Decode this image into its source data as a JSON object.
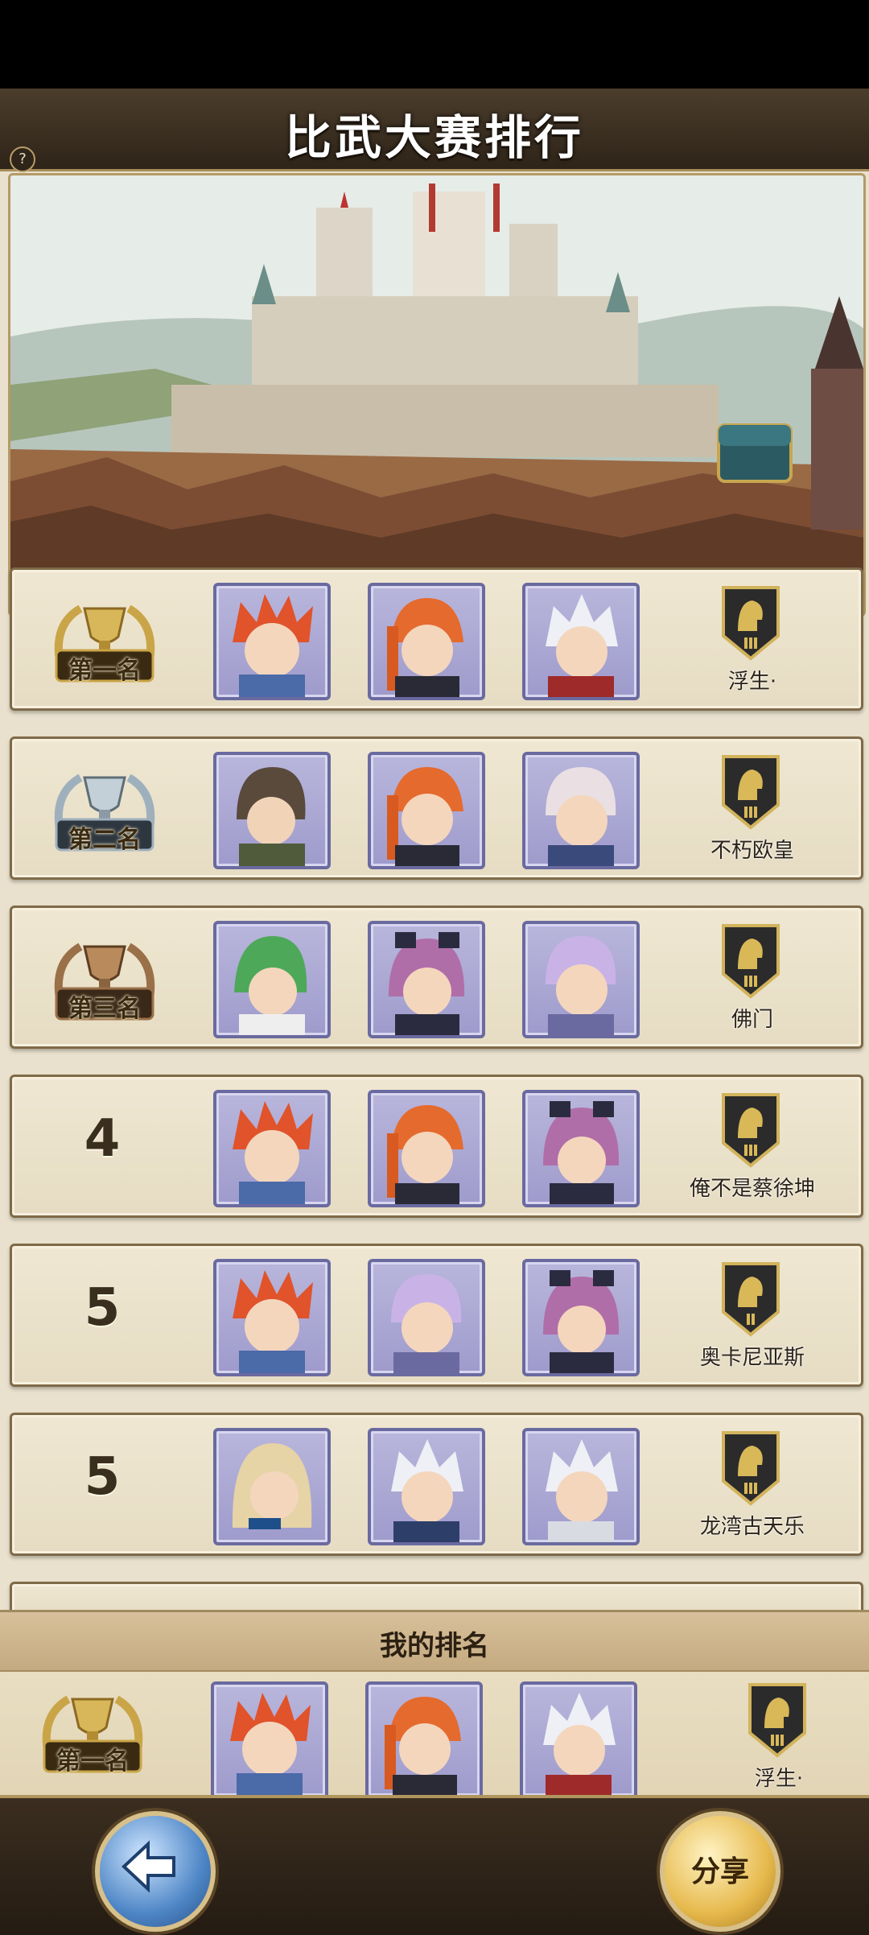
{
  "header": {
    "title": "比武大赛排行",
    "help_icon": "?"
  },
  "rankings": [
    {
      "rank_type": "medal",
      "medal": "gold",
      "rank_label": "第一名",
      "heroes": [
        "red-spiky-hero",
        "orange-ponytail-hero",
        "white-hair-hero"
      ],
      "player_name": "浮生·"
    },
    {
      "rank_type": "medal",
      "medal": "silver",
      "rank_label": "第二名",
      "heroes": [
        "brown-hair-hero",
        "orange-ponytail-hero",
        "pink-white-hero"
      ],
      "player_name": "不朽欧皇"
    },
    {
      "rank_type": "medal",
      "medal": "bronze",
      "rank_label": "第三名",
      "heroes": [
        "green-hair-hero",
        "purple-ribbon-hero",
        "lavender-hair-hero"
      ],
      "player_name": "佛门"
    },
    {
      "rank_type": "number",
      "rank_label": "4",
      "heroes": [
        "red-spiky-hero",
        "orange-ponytail-hero",
        "purple-ribbon-hero"
      ],
      "player_name": "俺不是蔡徐坤"
    },
    {
      "rank_type": "number",
      "rank_label": "5",
      "heroes": [
        "red-spiky-hero",
        "lavender-hair-hero",
        "purple-ribbon-hero"
      ],
      "player_name": "奥卡尼亚斯"
    },
    {
      "rank_type": "number",
      "rank_label": "5",
      "heroes": [
        "blonde-hero",
        "white-hair-hero",
        "white-hair-hero"
      ],
      "player_name": "龙湾古天乐"
    }
  ],
  "my_rank": {
    "title": "我的排名",
    "rank_label": "第一名",
    "medal": "gold",
    "heroes": [
      "red-spiky-hero",
      "orange-ponytail-hero",
      "white-hair-hero"
    ],
    "player_name": "浮生·"
  },
  "footer": {
    "share_label": "分享",
    "back_icon": "back-arrow-icon"
  },
  "colors": {
    "gold": "#c9a547",
    "silver": "#9fb0bd",
    "bronze": "#9a7048",
    "hero_frame": "#6a6aa0"
  }
}
